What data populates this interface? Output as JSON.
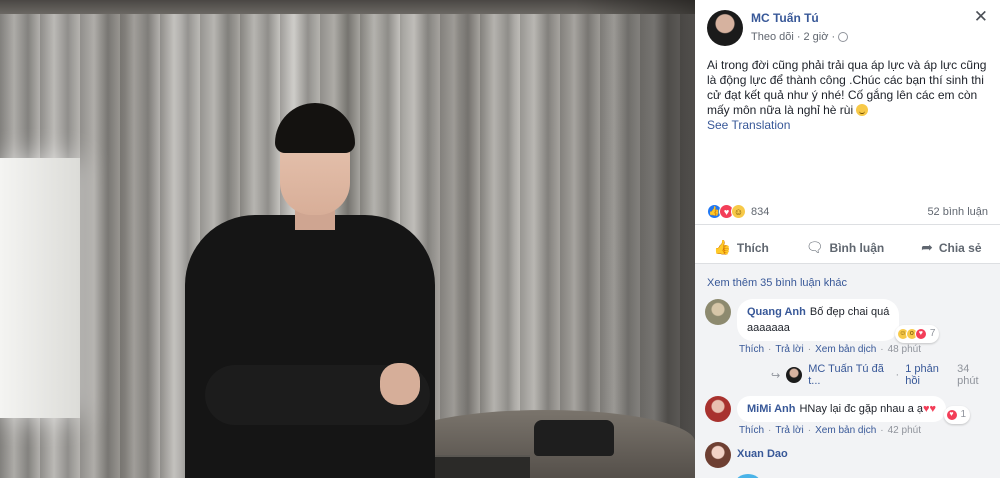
{
  "post": {
    "author": "MC Tuấn Tú",
    "follow": "Theo dõi",
    "sep": "·",
    "time": "2 giờ",
    "text": "Ai trong đời cũng phải trải qua áp lực và áp lực cũng là động lực để thành công .Chúc các bạn thí sinh thi cử đạt kết quả như ý nhé! Cố gắng lên các em còn mấy môn nữa là nghỉ hè rùi",
    "see_translation": "See Translation",
    "reaction_count": "834",
    "comment_count": "52 bình luận"
  },
  "actions": {
    "like": "Thích",
    "comment": "Bình luận",
    "share": "Chia sẻ"
  },
  "comments_section": {
    "view_more": "Xem thêm 35 bình luận khác",
    "items": [
      {
        "name": "Quang Anh",
        "text_line1": "Bố đẹp chai quá",
        "text_line2": "aaaaaaa",
        "reaction_count": "7",
        "like": "Thích",
        "reply": "Trả lời",
        "translate": "Xem bản dịch",
        "time": "48 phút"
      },
      {
        "name": "MiMi Anh",
        "text": "HNay lại đc gặp nhau a ạ",
        "reaction_count": "1",
        "like": "Thích",
        "reply": "Trả lời",
        "translate": "Xem bản dịch",
        "time": "42 phút"
      },
      {
        "name": "Xuan Dao"
      }
    ],
    "reply_summary": {
      "author": "MC Tuấn Tú đã t...",
      "sep": "·",
      "count": "1 phản hồi",
      "time": "34 phút"
    }
  },
  "icons": {
    "close": "close-icon",
    "globe": "globe-icon",
    "like": "thumbs-up-icon",
    "comment": "speech-bubble-icon",
    "share": "share-arrow-icon"
  },
  "colors": {
    "link_blue": "#385898",
    "like_blue": "#2078f4",
    "love_red": "#f33e58",
    "haha_yellow": "#f7c948",
    "comment_bg": "#f2f3f5"
  }
}
